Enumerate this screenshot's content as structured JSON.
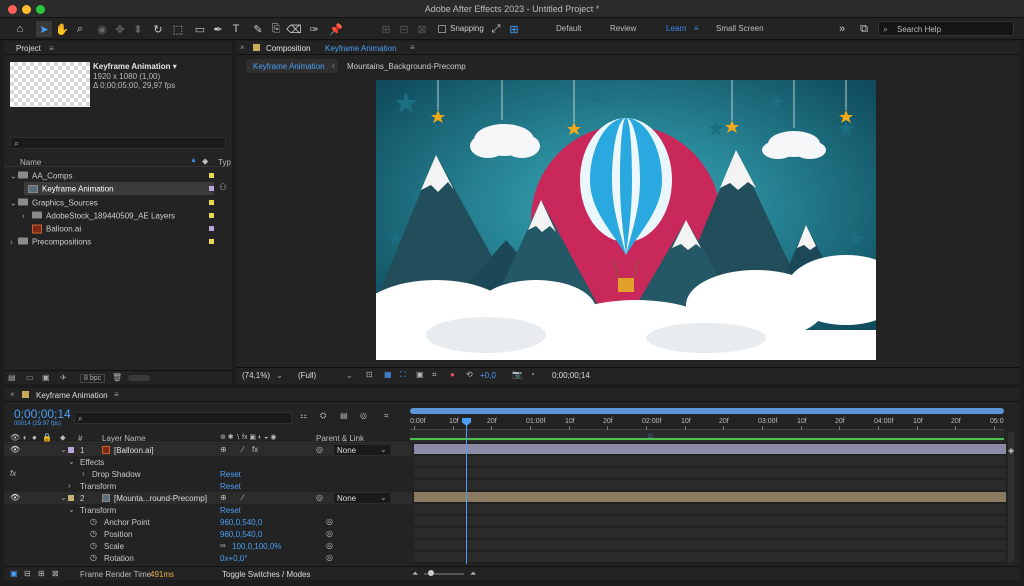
{
  "app": {
    "title": "Adobe After Effects 2023 - Untitled Project *"
  },
  "toolbar": {
    "snapping_label": "Snapping",
    "search_help_placeholder": "Search Help"
  },
  "workspaces": [
    {
      "label": "Default"
    },
    {
      "label": "Review"
    },
    {
      "label": "Learn"
    },
    {
      "label": "Small Screen"
    }
  ],
  "project": {
    "panel_title": "Project",
    "comp_name": "Keyframe Animation",
    "comp_info1": "1920 x 1080 (1,00)",
    "comp_info2": "Δ 0;00;05;00, 29,97 fps",
    "col_name": "Name",
    "col_type": "Typ",
    "bpc": "8 bpc",
    "items": [
      {
        "label": "AA_Comps"
      },
      {
        "label": "Keyframe Animation"
      },
      {
        "label": "Graphics_Sources"
      },
      {
        "label": "AdobeStock_189440509_AE Layers"
      },
      {
        "label": "Balloon.ai"
      },
      {
        "label": "Precompositions"
      }
    ]
  },
  "composition": {
    "panel_label": "Composition",
    "panel_name": "Keyframe Animation",
    "tabs": [
      {
        "label": "Keyframe Animation"
      },
      {
        "label": "Mountains_Background-Precomp"
      }
    ],
    "zoom": "(74,1%)",
    "resolution": "(Full)",
    "exposure": "+0,0",
    "timecode": "0;00;00;14"
  },
  "timeline": {
    "tab_label": "Keyframe Animation",
    "current_time": "0;00;00;14",
    "frame_info": "00014 (29.97 fps)",
    "search_placeholder": "",
    "col_layer_name": "Layer Name",
    "col_parent": "Parent & Link",
    "col_num": "#",
    "ruler": [
      "0:00f",
      "10f",
      "20f",
      "01:00f",
      "10f",
      "20f",
      "02:00f",
      "10f",
      "20f",
      "03:00f",
      "10f",
      "20f",
      "04:00f",
      "10f",
      "20f",
      "05:0"
    ],
    "layers": [
      {
        "num": "1",
        "name": "[Balloon.ai]",
        "parent": "None",
        "effects": "Effects",
        "drop_shadow": "Drop Shadow",
        "reset1": "Reset",
        "transform": "Transform",
        "reset2": "Reset"
      },
      {
        "num": "2",
        "name": "[Mounta...round-Precomp]",
        "parent": "None",
        "transform": "Transform",
        "reset": "Reset",
        "props": [
          {
            "name": "Anchor Point",
            "value": "960,0,540,0"
          },
          {
            "name": "Position",
            "value": "960,0,540,0"
          },
          {
            "name": "Scale",
            "value": "100,0,100,0%"
          },
          {
            "name": "Rotation",
            "value": "0x+0,0°"
          }
        ]
      }
    ],
    "footer_render_label": "Frame Render Time",
    "footer_render_value": "491ms",
    "footer_toggle": "Toggle Switches / Modes"
  },
  "colors": {
    "accent": "#3d8eea",
    "label_yellow": "#e6d84a",
    "label_lavender": "#b9a6d9",
    "track_tan": "#8a7a62"
  }
}
